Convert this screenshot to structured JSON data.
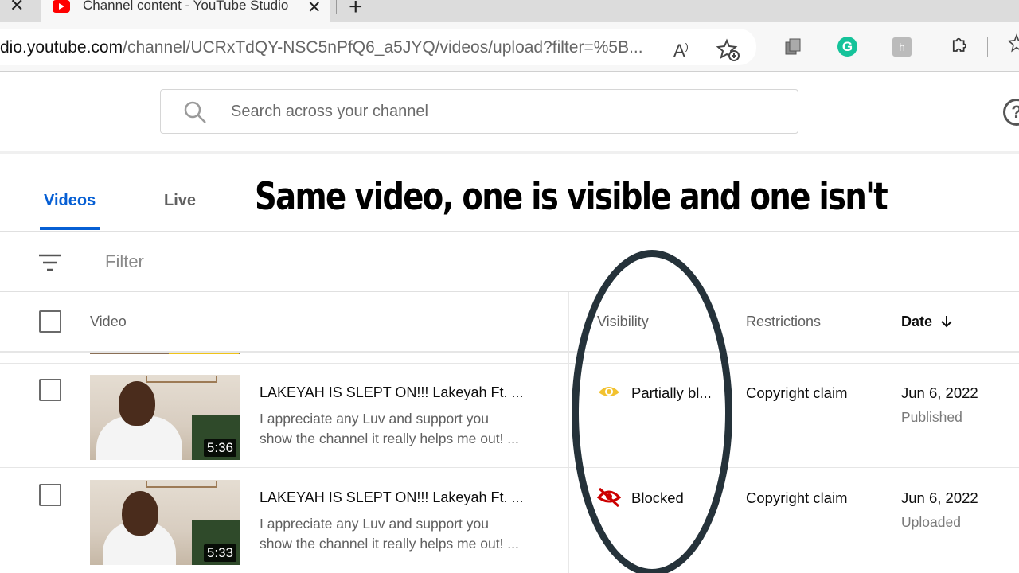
{
  "browser": {
    "tab_title": "Channel content - YouTube Studio",
    "tab_close": "✕",
    "tab_close_left": "✕",
    "new_tab": "+",
    "url_prefix": "dio.",
    "url_domain": "youtube.com",
    "url_path": "/channel/UCRxTdQY-NSC5nPfQ6_a5JYQ/videos/upload?filter=%5B...",
    "extension_h_label": "h"
  },
  "header": {
    "search_placeholder": "Search across your channel",
    "help_glyph": "?"
  },
  "tabs": [
    {
      "label": "Videos",
      "active": true
    },
    {
      "label": "Live",
      "active": false
    }
  ],
  "caption": "Same video, one is visible and one isn't",
  "filter": {
    "label": "Filter"
  },
  "table": {
    "columns": {
      "video": "Video",
      "visibility": "Visibility",
      "restrictions": "Restrictions",
      "date": "Date"
    },
    "rows": [
      {
        "title": "LAKEYAH IS SLEPT ON!!! Lakeyah Ft. ...",
        "description_line1": "I appreciate any Luv and support you",
        "description_line2": "show the channel it really helps me out! ...",
        "duration": "5:36",
        "visibility": "Partially bl...",
        "visibility_icon": "eye-icon",
        "visibility_color": "#f2c230",
        "restrictions": "Copyright claim",
        "date": "Jun 6, 2022",
        "status": "Published"
      },
      {
        "title": "LAKEYAH IS SLEPT ON!!! Lakeyah Ft. ...",
        "description_line1": "I appreciate any Luv and support you",
        "description_line2": "show the channel it really helps me out! ...",
        "duration": "5:33",
        "visibility": "Blocked",
        "visibility_icon": "eye-off-icon",
        "visibility_color": "#cc0000",
        "restrictions": "Copyright claim",
        "date": "Jun 6, 2022",
        "status": "Uploaded"
      }
    ]
  },
  "colors": {
    "accent": "#065fd4",
    "annotation_ring": "#25323a"
  }
}
